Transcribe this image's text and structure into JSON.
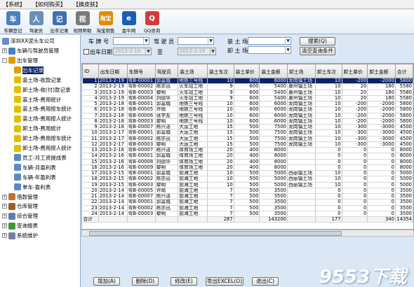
{
  "menu": [
    "【系统】",
    "【如何购买】",
    "【换皮肤】"
  ],
  "toolbar": [
    {
      "label": "车辆登记",
      "color": "#4a7fc0",
      "glyph": "车"
    },
    {
      "label": "驾驶员",
      "color": "#6a8fb8",
      "glyph": "人"
    },
    {
      "label": "出车记录",
      "color": "#3f6fae",
      "glyph": "记"
    },
    {
      "label": "视频帮助",
      "color": "#7a7a7a",
      "glyph": "视"
    },
    {
      "label": "淘宝销售",
      "color": "#e68a00",
      "glyph": "淘宝"
    },
    {
      "label": "金牛网",
      "color": "#1b5fb0",
      "glyph": "e"
    },
    {
      "label": "QQ咨询",
      "color": "#d23b3b",
      "glyph": "Q"
    }
  ],
  "tree": {
    "root": "深圳XX泥头车公司",
    "items": [
      {
        "label": "车辆与驾驶员管理",
        "level": 1,
        "exp": "+",
        "color": "#4a7fc0"
      },
      {
        "label": "出车管理",
        "level": 1,
        "exp": "-",
        "color": "#d9a100"
      },
      {
        "label": "出车记录",
        "level": 2,
        "color": "#d9a100"
      },
      {
        "label": "装土场-收款记录",
        "level": 2,
        "color": "#e0c000"
      },
      {
        "label": "卸土场-收(付)款记录",
        "level": 2,
        "color": "#e0c000"
      },
      {
        "label": "装土场-费用统计",
        "level": 2,
        "color": "#e0c000"
      },
      {
        "label": "装土场-费用按车统计",
        "level": 2,
        "color": "#e0c000"
      },
      {
        "label": "装土场-费用按人统计",
        "level": 2,
        "color": "#e0c000"
      },
      {
        "label": "卸土场-费用统计",
        "level": 2,
        "color": "#e0c000"
      },
      {
        "label": "卸土场-费用按车统计",
        "level": 2,
        "color": "#e0c000"
      },
      {
        "label": "卸土场-费用按人统计",
        "level": 2,
        "color": "#e0c000"
      },
      {
        "label": "员工-月工资提成表",
        "level": 2,
        "color": "#5a8ac0"
      },
      {
        "label": "车辆-月盈利表",
        "level": 2,
        "color": "#5a8ac0"
      },
      {
        "label": "车辆-年盈利表",
        "level": 2,
        "color": "#5a8ac0"
      },
      {
        "label": "单车-盈利表",
        "level": 2,
        "color": "#5a8ac0"
      },
      {
        "label": "借款管理",
        "level": 1,
        "exp": "+",
        "color": "#c07030"
      },
      {
        "label": "仓库管理",
        "level": 1,
        "exp": "+",
        "color": "#a05a2c"
      },
      {
        "label": "综合管理",
        "level": 1,
        "exp": "+",
        "color": "#5a7fb0"
      },
      {
        "label": "查询报表",
        "level": 1,
        "exp": "+",
        "color": "#3a9a3a"
      },
      {
        "label": "系统维护",
        "level": 1,
        "exp": "+",
        "color": "#7080a0"
      }
    ]
  },
  "filter": {
    "plate_label": "车 牌 号",
    "driver_label": "驾 驶 员",
    "load_label": "装 土 场",
    "unload_label": "卸 土 场",
    "date_label": "出车日期",
    "to_label": "至",
    "date_from": "2013-2-19",
    "date_to": "2013-2-19",
    "search": "搜索(Q)",
    "clear": "清空查询条件"
  },
  "columns": [
    "ID",
    "出车日期",
    "车牌号",
    "驾驶员",
    "装土场",
    "装土车次",
    "装土单价",
    "装土金额",
    "卸土场",
    "卸土车次",
    "卸土单价",
    "卸土金额",
    "合计"
  ],
  "rows": [
    [
      "1",
      "2013-2-19",
      "粤B-00001",
      "郭富城",
      "地铁三号线",
      "10",
      "600",
      "6000",
      "龙岗镇土场",
      "10",
      "-200",
      "-2000",
      "5800"
    ],
    [
      "2",
      "2013-2-19",
      "粤B-00002",
      "陈亦迅",
      "火车站工地",
      "9",
      "600",
      "5400",
      "惠州镇土场",
      "10",
      "20",
      "180",
      "5580"
    ],
    [
      "3",
      "2013-2-19",
      "粤B-00003",
      "黎明",
      "火车站工地",
      "9",
      "600",
      "5400",
      "惠州镇土场",
      "10",
      "20",
      "180",
      "5580"
    ],
    [
      "4",
      "2013-2-19",
      "粤B-00004",
      "刘德华",
      "火车站工地",
      "9",
      "600",
      "5400",
      "惠州镇土场",
      "10",
      "20",
      "180",
      "5580"
    ],
    [
      "5",
      "2013-2-18",
      "粤B-00001",
      "郭富城",
      "地铁三号线",
      "10",
      "600",
      "6000",
      "龙岗镇土场",
      "10",
      "-200",
      "-2000",
      "5800"
    ],
    [
      "6",
      "2013-2-18",
      "粤B-00005",
      "许晴",
      "地铁三号线",
      "10",
      "600",
      "6000",
      "龙岗镇土场",
      "10",
      "-200",
      "-2000",
      "5800"
    ],
    [
      "7",
      "2013-2-18",
      "粤B-00006",
      "张学友",
      "地铁三号线",
      "10",
      "600",
      "6000",
      "龙岗镇土场",
      "10",
      "-200",
      "-2000",
      "5800"
    ],
    [
      "8",
      "2013-2-18",
      "粤B-00003",
      "黎明",
      "地铁三号线",
      "10",
      "600",
      "6000",
      "龙岗镇土场",
      "10",
      "-200",
      "-2000",
      "5800"
    ],
    [
      "9",
      "2013-2-18",
      "粤B-00007",
      "陈兴洁",
      "大运工地",
      "15",
      "500",
      "7500",
      "龙岗镇土场",
      "10",
      "-300",
      "-3000",
      "4500"
    ],
    [
      "10",
      "2013-2-17",
      "粤B-00001",
      "郭富城",
      "大运工地",
      "15",
      "500",
      "7500",
      "龙岗镇土场",
      "10",
      "-300",
      "-3000",
      "4500"
    ],
    [
      "11",
      "2013-2-17",
      "粤B-00002",
      "陈亦迅",
      "大运工地",
      "15",
      "500",
      "7500",
      "龙岗镇土场",
      "10",
      "-300",
      "-3000",
      "4500"
    ],
    [
      "12",
      "2013-2-17",
      "粤B-00003",
      "黎明",
      "大运工地",
      "15",
      "500",
      "7500",
      "龙岗镇土场",
      "10",
      "-300",
      "-3000",
      "4500"
    ],
    [
      "13",
      "2013-2-16",
      "粤B-00007",
      "陈兴洁",
      "体育场工地",
      "20",
      "400",
      "8000",
      "",
      "0",
      "0",
      "0",
      "8000"
    ],
    [
      "14",
      "2013-2-16",
      "粤B-00001",
      "郭富城",
      "体育场工地",
      "20",
      "400",
      "8000",
      "",
      "0",
      "0",
      "0",
      "8000"
    ],
    [
      "15",
      "2013-2-16",
      "粤B-00008",
      "刘德华",
      "体育场工地",
      "20",
      "400",
      "8000",
      "",
      "0",
      "0",
      "0",
      "8000"
    ],
    [
      "16",
      "2013-2-16",
      "粤B-00009",
      "黎明",
      "体育场工地",
      "20",
      "400",
      "8000",
      "",
      "0",
      "0",
      "0",
      "8000"
    ],
    [
      "17",
      "2013-2-15",
      "粤B-00001",
      "郭富城",
      "前海工地",
      "10",
      "500",
      "5000",
      "西丽镇土场",
      "10",
      "0",
      "0",
      "5000"
    ],
    [
      "18",
      "2013-2-15",
      "粤B-00002",
      "陈亦迅",
      "前海工地",
      "10",
      "500",
      "5000",
      "西丽镇土场",
      "10",
      "0",
      "0",
      "5000"
    ],
    [
      "19",
      "2013-2-15",
      "粤B-00003",
      "黎明",
      "前海工地",
      "10",
      "500",
      "5000",
      "西丽镇土场",
      "10",
      "0",
      "0",
      "5000"
    ],
    [
      "20",
      "2013-2-14",
      "粤B-00005",
      "许晴",
      "前海工地",
      "7",
      "500",
      "3500",
      "",
      "0",
      "0",
      "0",
      "3500"
    ],
    [
      "21",
      "2013-2-14",
      "粤B-00007",
      "陈兴洁",
      "前海工地",
      "7",
      "500",
      "3500",
      "",
      "0",
      "0",
      "0",
      "3500"
    ],
    [
      "22",
      "2013-2-14",
      "粤B-00001",
      "郭富城",
      "前海工地",
      "7",
      "500",
      "3500",
      "",
      "0",
      "0",
      "0",
      "3500"
    ],
    [
      "23",
      "2013-2-14",
      "粤B-00002",
      "陈亦迅",
      "前海工地",
      "7",
      "500",
      "3500",
      "",
      "0",
      "0",
      "0",
      "3500"
    ],
    [
      "24",
      "2013-2-14",
      "粤B-00003",
      "黎明",
      "前海工地",
      "7",
      "500",
      "3500",
      "",
      "0",
      "0",
      "0",
      "3500"
    ]
  ],
  "totals": [
    "合计",
    "",
    "",
    "",
    "",
    "287",
    "",
    "143200",
    "",
    "177",
    "",
    "340",
    "14354"
  ],
  "buttons": [
    "增加(A)",
    "删除(D)",
    "修改(E)",
    "导出EXCEL(O)",
    "退出(C)"
  ],
  "watermark": "9553下载"
}
